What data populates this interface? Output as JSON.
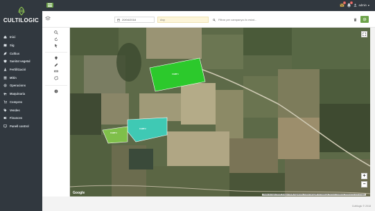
{
  "brand": {
    "name": "CULTILOGIC"
  },
  "sidebar": {
    "items": [
      {
        "label": "Inici",
        "icon": "home-icon"
      },
      {
        "label": "Sig",
        "icon": "map-icon"
      },
      {
        "label": "Cultius",
        "icon": "leaf-icon"
      },
      {
        "label": "Sanitat vegetal",
        "icon": "shield-icon"
      },
      {
        "label": "Fertilització",
        "icon": "flask-icon"
      },
      {
        "label": "Mitin",
        "icon": "list-icon"
      },
      {
        "label": "Operacions",
        "icon": "gear-icon"
      },
      {
        "label": "Maquinaria",
        "icon": "tractor-icon"
      },
      {
        "label": "Compres",
        "icon": "cart-icon"
      },
      {
        "label": "Vendes",
        "icon": "tag-icon"
      },
      {
        "label": "Finances",
        "icon": "wallet-icon"
      },
      {
        "label": "Panell control",
        "icon": "monitor-icon"
      }
    ]
  },
  "topbar": {
    "user": "admin",
    "notifications": [
      "1",
      "1"
    ]
  },
  "filters": {
    "date": "20/04/2018",
    "year_placeholder": "Any",
    "search_placeholder": "Filtrar per campanya i/o estat..."
  },
  "map": {
    "attribution": "Dades de mapa ©2018 | Imatges ©2018, DigitalGlobe, Institut Cartogràfic de Catalunya | Termes i condicions | Informa d'un error al mapa",
    "google": "Google",
    "fields": [
      {
        "label": "CAMP 1",
        "color": "#2cc92c"
      },
      {
        "label": "CAMP 2",
        "color": "#3fc9b4"
      },
      {
        "label": "CAMP 3",
        "color": "#7fbf4a"
      }
    ]
  },
  "footer": {
    "text": "Cultilogic © 2018"
  },
  "colors": {
    "accent": "#6ea34a",
    "sidebar": "#31383f"
  }
}
